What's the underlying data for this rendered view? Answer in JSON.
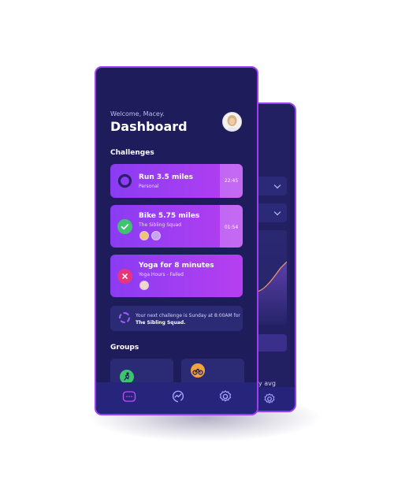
{
  "header": {
    "welcome": "Welcome, Macey.",
    "title": "Dashboard"
  },
  "sections": {
    "challenges": "Challenges",
    "groups": "Groups"
  },
  "challenges": [
    {
      "title": "Run 3.5 miles",
      "subtitle": "Personal",
      "time": "22:45",
      "status": "in-progress"
    },
    {
      "title": "Bike 5.75 miles",
      "subtitle": "The Sibling Squad",
      "time": "01:54",
      "status": "completed"
    },
    {
      "title": "Yoga for 8 minutes",
      "subtitle": "Yoga Hours - Failed",
      "time": "",
      "status": "failed"
    }
  ],
  "next_challenge": {
    "text": "Your next challenge is Sunday at 8:00AM for ",
    "group": "The Sibling Squad."
  },
  "back_screen": {
    "avg_text": "y avg"
  },
  "nav": {
    "items": [
      "messages-icon",
      "activity-icon",
      "settings-icon"
    ],
    "active": "messages-icon"
  },
  "colors": {
    "background": "#1e1c5b",
    "accent": "#a03ff2",
    "card_gradient_start": "#8a3cf2",
    "card_gradient_end": "#b63ff0",
    "success": "#3ec46d",
    "danger": "#e8367a"
  }
}
